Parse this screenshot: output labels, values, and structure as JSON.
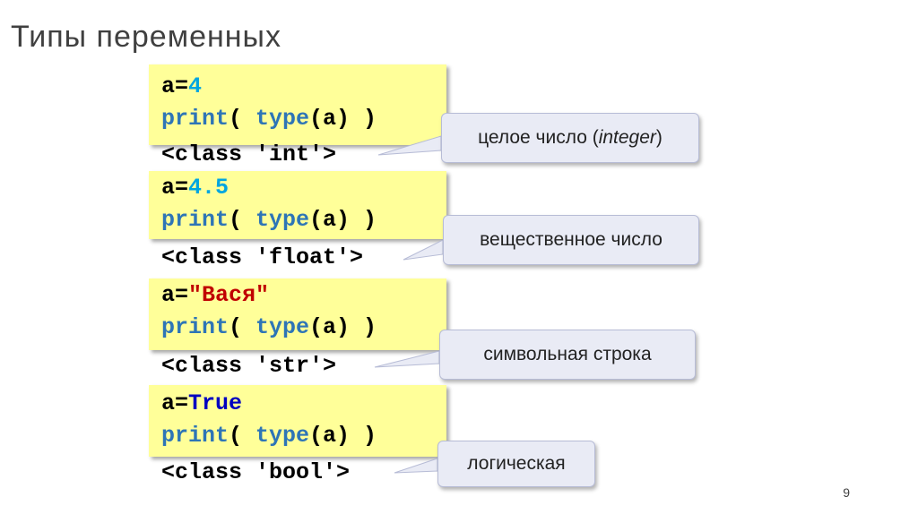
{
  "title": "Типы переменных",
  "page_number": "9",
  "colors": {
    "code_bg": "#ffff99",
    "number": "#00a5e0",
    "string": "#c00000",
    "keyword": "#0000c0",
    "builtin": "#2e75b6",
    "callout_bg": "#e9ebf5"
  },
  "blocks": [
    {
      "var": "a",
      "op": "=",
      "value": "4",
      "print_kw": "print",
      "type_fn": "type",
      "call_args": "(a) )",
      "open_paren": "(",
      "output": "<class 'int'>",
      "callout_pre": "целое число (",
      "callout_em": "integer",
      "callout_post": ")"
    },
    {
      "var": "a",
      "op": "=",
      "value": "4.5",
      "print_kw": "print",
      "type_fn": "type",
      "call_args": "(a) )",
      "open_paren": "(",
      "output": "<class 'float'>",
      "callout_pre": "вещественное число",
      "callout_em": "",
      "callout_post": ""
    },
    {
      "var": "a",
      "op": "=",
      "value": "\"Вася\"",
      "print_kw": "print",
      "type_fn": "type",
      "call_args": "(a) )",
      "open_paren": "(",
      "output": "<class 'str'>",
      "callout_pre": "символьная строка",
      "callout_em": "",
      "callout_post": ""
    },
    {
      "var": "a",
      "op": "=",
      "value": "True",
      "print_kw": "print",
      "type_fn": "type",
      "call_args": "(a) )",
      "open_paren": "(",
      "output": "<class 'bool'>",
      "callout_pre": "логическая",
      "callout_em": "",
      "callout_post": ""
    }
  ]
}
